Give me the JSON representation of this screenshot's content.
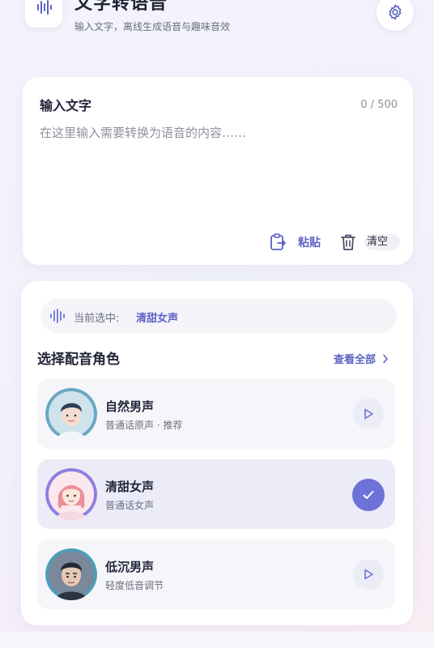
{
  "header": {
    "title": "文字转语音",
    "subtitle": "输入文字，离线生成语音与趣味音效",
    "logo_icon": "waveform-icon",
    "settings_icon": "gear-icon"
  },
  "input": {
    "label": "输入文字",
    "char_count": "0 / 500",
    "placeholder": "在这里输入需要转换为语音的内容……",
    "value": "",
    "paste_label": "粘贴",
    "clear_label": "清空"
  },
  "voices": {
    "current_label": "当前选中:",
    "current_value": "清甜女声",
    "section_title": "选择配音角色",
    "view_all_label": "查看全部",
    "items": [
      {
        "name": "自然男声",
        "desc": "普通话原声 · 推荐",
        "selected": false
      },
      {
        "name": "清甜女声",
        "desc": "普通话女声",
        "selected": true
      },
      {
        "name": "低沉男声",
        "desc": "轻度低音调节",
        "selected": false
      }
    ]
  },
  "colors": {
    "accent": "#5b63c4",
    "accent_button": "#6c72d8",
    "selected_bg": "#ececf9"
  }
}
